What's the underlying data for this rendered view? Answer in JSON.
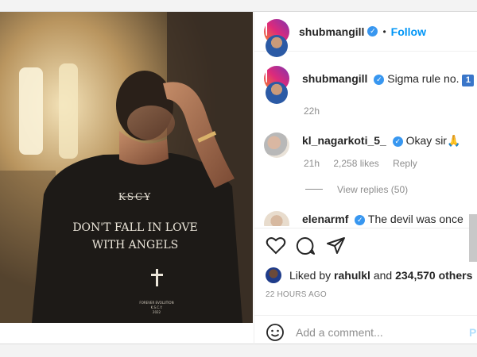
{
  "post": {
    "author": "shubmangill",
    "follow_label": "Follow",
    "dot": "•",
    "shirt_brand": "KSCY",
    "shirt_line1": "DON'T FALL IN LOVE",
    "shirt_line2": "WITH ANGELS",
    "shirt_small": "FOREVER EVOLUTION",
    "shirt_small2": "K.S.C.Y.",
    "shirt_year": "2022"
  },
  "caption": {
    "user": "shubmangill",
    "text": "Sigma rule no.",
    "badge": "1",
    "time": "22h"
  },
  "comments": [
    {
      "user": "kl_nagarkoti_5_",
      "text": "Okay sir",
      "emoji": "🙏",
      "time": "21h",
      "likes": "2,258 likes",
      "reply": "Reply",
      "view_replies": "View replies (50)"
    },
    {
      "user": "elenarmf",
      "text": "The devil was once an"
    }
  ],
  "likes": {
    "prefix": "Liked by",
    "user": "rahulkl",
    "connector": "and",
    "others": "234,570 others"
  },
  "timestamp": "22 HOURS AGO",
  "add_comment": {
    "emoji_icon": "smile-icon",
    "placeholder": "Add a comment...",
    "post_label": "Po"
  },
  "colors": {
    "accent": "#0095f6",
    "verified": "#3897f0"
  }
}
